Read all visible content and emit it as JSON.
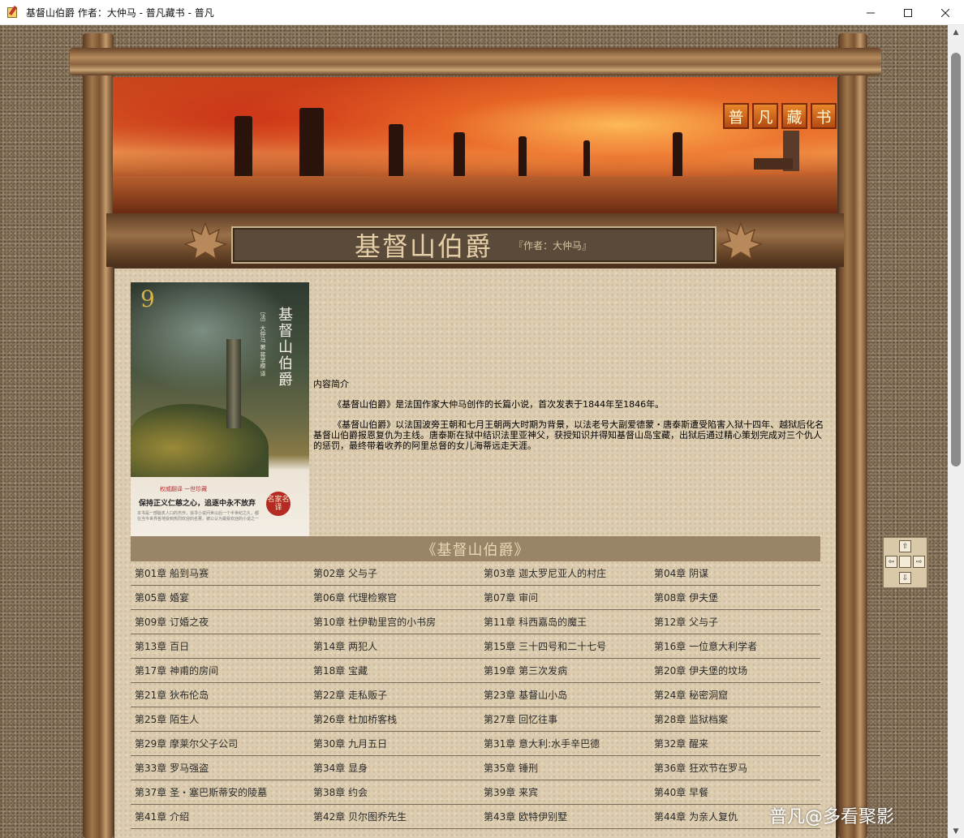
{
  "window": {
    "title": "基督山伯爵 作者：大仲马 - 普凡藏书 - 普凡",
    "minimize": "minimize-icon",
    "maximize": "maximize-icon",
    "close": "close-icon"
  },
  "header": {
    "logo_chars": [
      "普",
      "凡",
      "藏",
      "书"
    ],
    "book_title": "基督山伯爵",
    "author_line": "『作者：大仲马』"
  },
  "cover": {
    "badge": "9",
    "title": "基督山伯爵",
    "subtitle": "〔法〕大仲马 著 蒋学模 译",
    "tagline1": "权威翻译 一世珍藏",
    "tagline2": "保持正义仁慈之心，追逐中永不放弃",
    "description": "本书是一部脍炙人口的杰作，追寻小说问世以后一个半世纪之久，都在当今世界各地受到热烈欢迎的名著，被公认为最受欢迎的小说之一",
    "seal": "名家名译"
  },
  "intro": {
    "heading": "内容简介",
    "p1": "《基督山伯爵》是法国作家大仲马创作的长篇小说，首次发表于1844年至1846年。",
    "p2": "《基督山伯爵》以法国波旁王朝和七月王朝两大时期为背景，以法老号大副爱德蒙・唐泰斯遭受陷害入狱十四年、越狱后化名基督山伯爵报恩复仇为主线。唐泰斯在狱中结识法里亚神父，获授知识并得知基督山岛宝藏，出狱后通过精心策划完成对三个仇人的惩罚，最终带着收养的阿里总督的女儿海蒂远走天涯。"
  },
  "chapter_header": "《基督山伯爵》",
  "chapters": [
    [
      "第01章  船到马赛",
      "第02章  父与子",
      "第03章  迦太罗尼亚人的村庄",
      "第04章  阴谋"
    ],
    [
      "第05章  婚宴",
      "第06章  代理检察官",
      "第07章  审问",
      "第08章  伊夫堡"
    ],
    [
      "第09章  订婚之夜",
      "第10章  杜伊勒里宫的小书房",
      "第11章  科西嘉岛的魔王",
      "第12章  父与子"
    ],
    [
      "第13章  百日",
      "第14章  两犯人",
      "第15章  三十四号和二十七号",
      "第16章  一位意大利学者"
    ],
    [
      "第17章  神甫的房间",
      "第18章  宝藏",
      "第19章  第三次发病",
      "第20章  伊夫堡的坟场"
    ],
    [
      "第21章  狄布伦岛",
      "第22章  走私贩子",
      "第23章  基督山小岛",
      "第24章  秘密洞窟"
    ],
    [
      "第25章  陌生人",
      "第26章  杜加桥客栈",
      "第27章  回忆往事",
      "第28章  监狱档案"
    ],
    [
      "第29章  摩莱尔父子公司",
      "第30章  九月五日",
      "第31章  意大利:水手辛巴德",
      "第32章  醒来"
    ],
    [
      "第33章  罗马强盗",
      "第34章  显身",
      "第35章  锤刑",
      "第36章  狂欢节在罗马"
    ],
    [
      "第37章  圣・塞巴斯蒂安的陵墓",
      "第38章  约会",
      "第39章  来宾",
      "第40章  早餐"
    ],
    [
      "第41章  介绍",
      "第42章  贝尔图乔先生",
      "第43章  欧特伊别墅",
      "第44章  为亲人复仇"
    ]
  ],
  "watermark": "普凡@多看聚影",
  "colors": {
    "wood": "#8a6240",
    "parchment": "#ddcdb0",
    "chapter_bar": "#9a8468",
    "title_text": "#e6cfa6"
  }
}
